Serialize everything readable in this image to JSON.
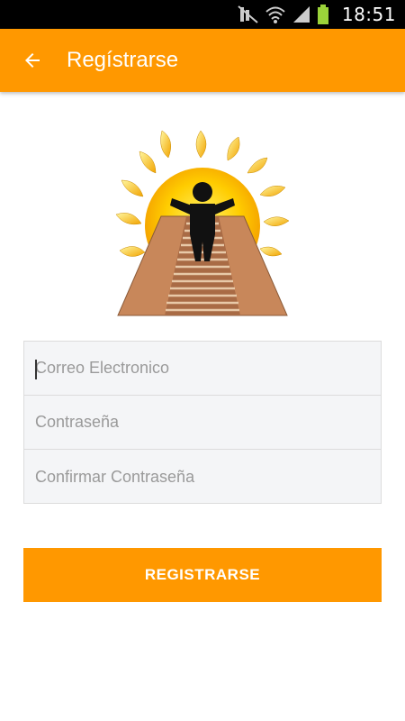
{
  "status_bar": {
    "time": "18:51",
    "icons": [
      "mute-icon",
      "wifi-icon",
      "signal-icon",
      "battery-icon"
    ]
  },
  "app_bar": {
    "title": "Regístrarse",
    "back_icon": "arrow-back-icon"
  },
  "logo": {
    "description_icon": "sun-figure-stairway-logo"
  },
  "form": {
    "email_placeholder": "Correo Electronico",
    "email_value": "",
    "password_placeholder": "Contraseña",
    "password_value": "",
    "confirm_placeholder": "Confirmar Contraseña",
    "confirm_value": ""
  },
  "actions": {
    "register_label": "REGISTRARSE"
  },
  "colors": {
    "accent": "#ff9800",
    "status_bar": "#000000",
    "field_bg": "#f4f5f7",
    "sun": "#ffcc00"
  }
}
